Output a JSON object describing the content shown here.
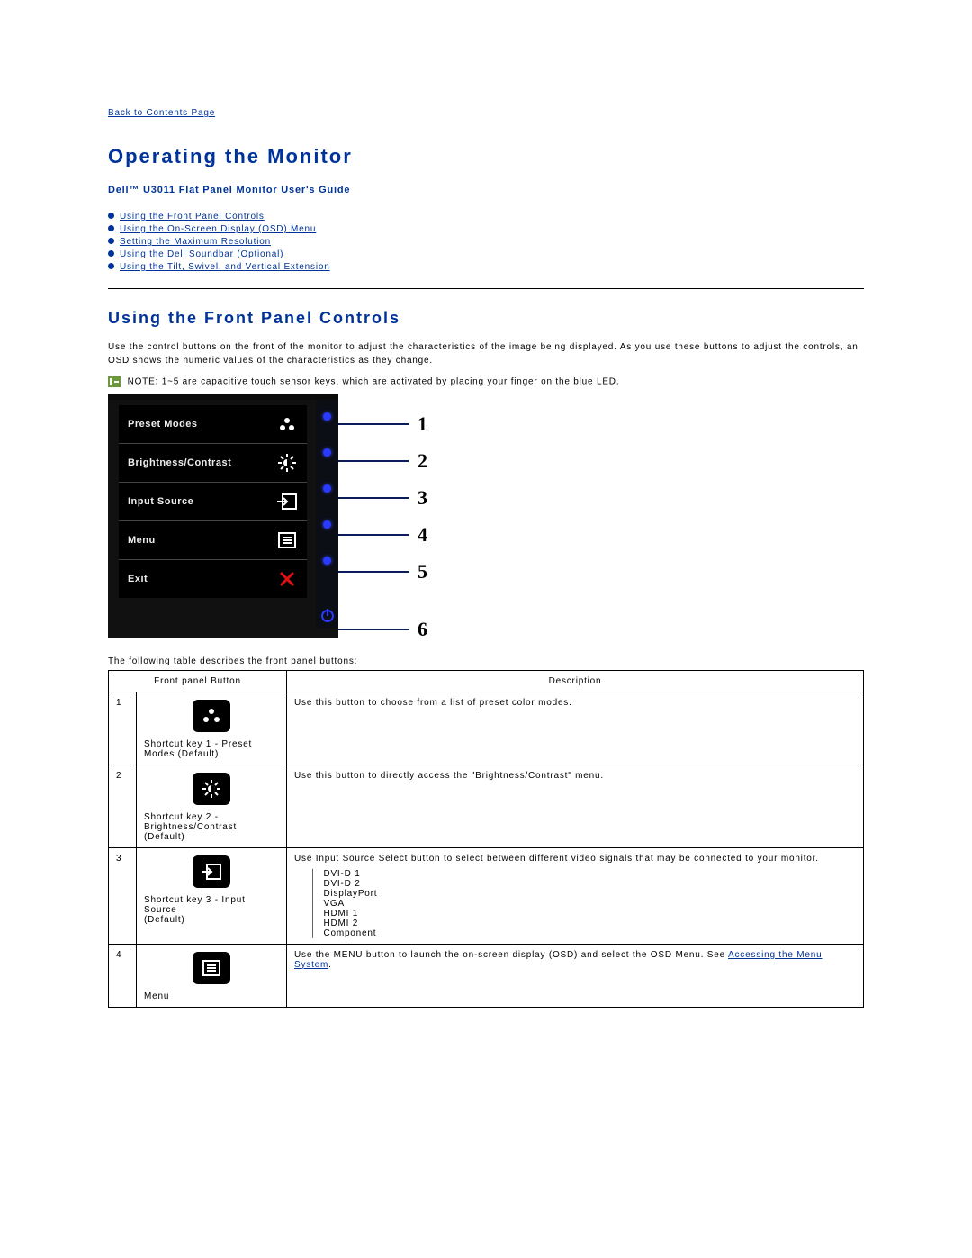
{
  "nav": {
    "back_link": "Back to Contents Page"
  },
  "title": "Operating the Monitor",
  "subtitle": "Dell™ U3011 Flat Panel Monitor User's Guide",
  "toc": [
    "Using the Front Panel Controls",
    "Using the On-Screen Display (OSD) Menu",
    "Setting the Maximum Resolution",
    "Using the Dell Soundbar (Optional)",
    "Using the Tilt, Swivel, and Vertical Extension"
  ],
  "section1": {
    "heading": "Using the Front Panel Controls",
    "para": "Use the control buttons on the front of the monitor to adjust the characteristics of the image being displayed. As you use these buttons to adjust the controls, an OSD shows the numeric values of the characteristics as they change.",
    "note_prefix": " NOTE:",
    "note": " 1~5 are capacitive touch sensor keys, which are activated by placing your finger on the blue LED."
  },
  "osd_items": [
    {
      "label": "Preset Modes"
    },
    {
      "label": "Brightness/Contrast"
    },
    {
      "label": "Input Source"
    },
    {
      "label": "Menu"
    },
    {
      "label": "Exit"
    }
  ],
  "callout_numbers": [
    "1",
    "2",
    "3",
    "4",
    "5",
    "6"
  ],
  "table_intro": "The following table describes the front panel buttons:",
  "table_headers": {
    "col1": "Front panel Button",
    "col2": "Description"
  },
  "rows": [
    {
      "n": "1",
      "label": "Shortcut key 1 - Preset Modes (Default)",
      "desc": "Use this button to choose from a list of preset color modes."
    },
    {
      "n": "2",
      "label": "Shortcut key 2 - Brightness/Contrast (Default)",
      "desc": "Use this button to directly access the \"Brightness/Contrast\" menu."
    },
    {
      "n": "3",
      "label": "Shortcut key 3 - Input Source",
      "label2": "(Default)",
      "desc": "Use Input Source Select button to select between different video signals that may be connected to your monitor.",
      "sources": [
        "DVI-D 1",
        "DVI-D 2",
        "DisplayPort",
        "VGA",
        "HDMI 1",
        "HDMI 2",
        "Component"
      ]
    },
    {
      "n": "4",
      "label": "Menu",
      "desc_pre": "Use the MENU button to launch the on-screen display (OSD) and select the OSD Menu. See ",
      "desc_link": "Accessing the Menu System",
      "desc_post": "."
    }
  ]
}
